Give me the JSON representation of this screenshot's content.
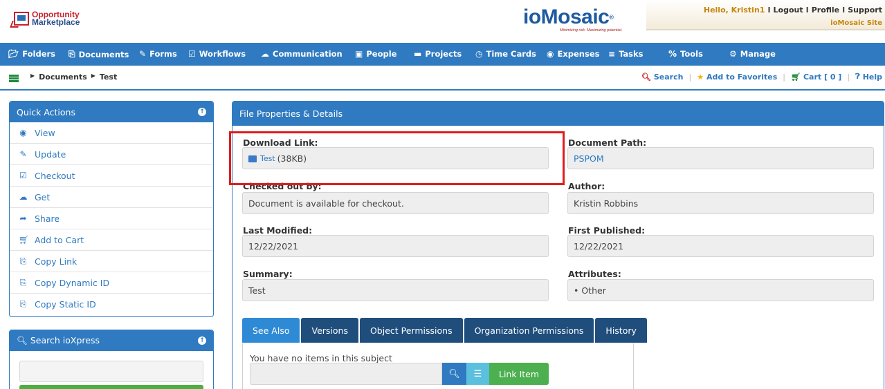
{
  "header": {
    "logo_line1": "Opportunity",
    "logo_line2": "Marketplace",
    "brand_name": "ioMosaic",
    "brand_tagline": "Minimizing risk. Maximizing potential.",
    "greeting": "Hello, Kristin1",
    "logout": "Logout",
    "profile": "Profile",
    "support": "Support",
    "site_link": "ioMosaic Site"
  },
  "nav": {
    "items": [
      {
        "label": "Folders",
        "icon": "folder-open-icon"
      },
      {
        "label": "Documents",
        "icon": "copy-icon"
      },
      {
        "label": "Forms",
        "icon": "edit-icon"
      },
      {
        "label": "Workflows",
        "icon": "check-square-icon"
      },
      {
        "label": "Communication",
        "icon": "comments-icon"
      },
      {
        "label": "People",
        "icon": "contact-card-icon"
      },
      {
        "label": "Projects",
        "icon": "folder-icon"
      },
      {
        "label": "Time Cards",
        "icon": "clock-icon"
      },
      {
        "label": "Expenses",
        "icon": "money-icon"
      },
      {
        "label": "Tasks",
        "icon": "list-icon"
      },
      {
        "label": "Tools",
        "icon": "percent-icon"
      },
      {
        "label": "Manage",
        "icon": "cogs-icon"
      }
    ]
  },
  "breadcrumb": {
    "items": [
      "Documents",
      "Test"
    ]
  },
  "actions": {
    "search": "Search",
    "favorites": "Add to Favorites",
    "cart": "Cart [ 0 ]",
    "help": "Help"
  },
  "quick_actions": {
    "title": "Quick Actions",
    "items": [
      {
        "label": "View",
        "icon": "eye-icon"
      },
      {
        "label": "Update",
        "icon": "edit-icon"
      },
      {
        "label": "Checkout",
        "icon": "check-square-icon"
      },
      {
        "label": "Get",
        "icon": "cloud-download-icon"
      },
      {
        "label": "Share",
        "icon": "share-icon"
      },
      {
        "label": "Add to Cart",
        "icon": "cart-icon"
      },
      {
        "label": "Copy Link",
        "icon": "copy-icon"
      },
      {
        "label": "Copy Dynamic ID",
        "icon": "copy-icon"
      },
      {
        "label": "Copy Static ID",
        "icon": "copy-icon"
      }
    ]
  },
  "search_panel": {
    "title": "Search ioXpress"
  },
  "file_props": {
    "title": "File Properties & Details",
    "download_label": "Download Link:",
    "download_name": "Test",
    "download_size": "(38KB)",
    "path_label": "Document Path:",
    "path_value": "PSPOM",
    "checked_label": "Checked out by:",
    "checked_value": "Document is available for checkout.",
    "author_label": "Author:",
    "author_value": "Kristin Robbins",
    "modified_label": "Last Modified:",
    "modified_value": "12/22/2021",
    "published_label": "First Published:",
    "published_value": "12/22/2021",
    "summary_label": "Summary:",
    "summary_value": "Test",
    "attributes_label": "Attributes:",
    "attributes_value": "• Other"
  },
  "tabs": {
    "items": [
      "See Also",
      "Versions",
      "Object Permissions",
      "Organization Permissions",
      "History"
    ],
    "active": "See Also",
    "empty_message": "You have no items in this subject",
    "link_button": "Link Item"
  },
  "colors": {
    "primary": "#2f7ac0",
    "highlight": "#e01b1b",
    "accent_orange": "#c7860d",
    "success": "#4caf50"
  }
}
